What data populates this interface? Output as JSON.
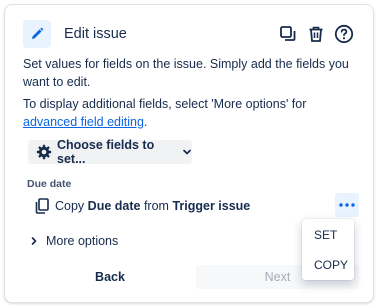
{
  "header": {
    "title": "Edit issue",
    "edit_icon": "pencil-icon",
    "actions": [
      "copy-icon",
      "trash-icon",
      "help-icon"
    ]
  },
  "description": {
    "line1": "Set values for fields on the issue. Simply add the fields you want to edit.",
    "line2_prefix": "To display additional fields, select 'More options' for ",
    "line2_link": "advanced field editing",
    "line2_suffix": "."
  },
  "choose_fields": {
    "label": "Choose fields to set...",
    "icon": "gear-icon"
  },
  "field": {
    "label": "Due date",
    "row": {
      "prefix": "Copy",
      "field_name": "Due date",
      "middle": "from",
      "source": "Trigger issue"
    }
  },
  "more_options": {
    "label": "More options"
  },
  "dropdown": {
    "items": [
      "SET",
      "COPY"
    ]
  },
  "footer": {
    "back_label": "Back",
    "next_label": "Next"
  },
  "colors": {
    "accent": "#0c66e4",
    "accent_bg": "#e9f2ff",
    "text": "#172b4d",
    "subtle": "#44546f",
    "disabled_text": "#a5adba"
  }
}
